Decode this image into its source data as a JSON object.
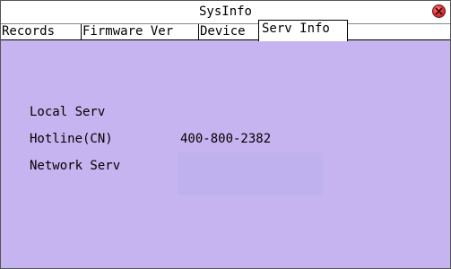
{
  "window": {
    "title": "SysInfo"
  },
  "tabs": [
    {
      "label": "Records",
      "active": false
    },
    {
      "label": "Firmware Ver",
      "active": false
    },
    {
      "label": "Device",
      "active": false
    },
    {
      "label": "Serv Info",
      "active": true
    }
  ],
  "serv_info": {
    "local_serv_label": "Local Serv",
    "hotline_label": "Hotline(CN)",
    "hotline_value": "400-800-2382",
    "network_serv_label": "Network Serv",
    "network_serv_value": ""
  },
  "colors": {
    "panel_background": "#c6b4f0",
    "close_button": "#e63b3b"
  }
}
